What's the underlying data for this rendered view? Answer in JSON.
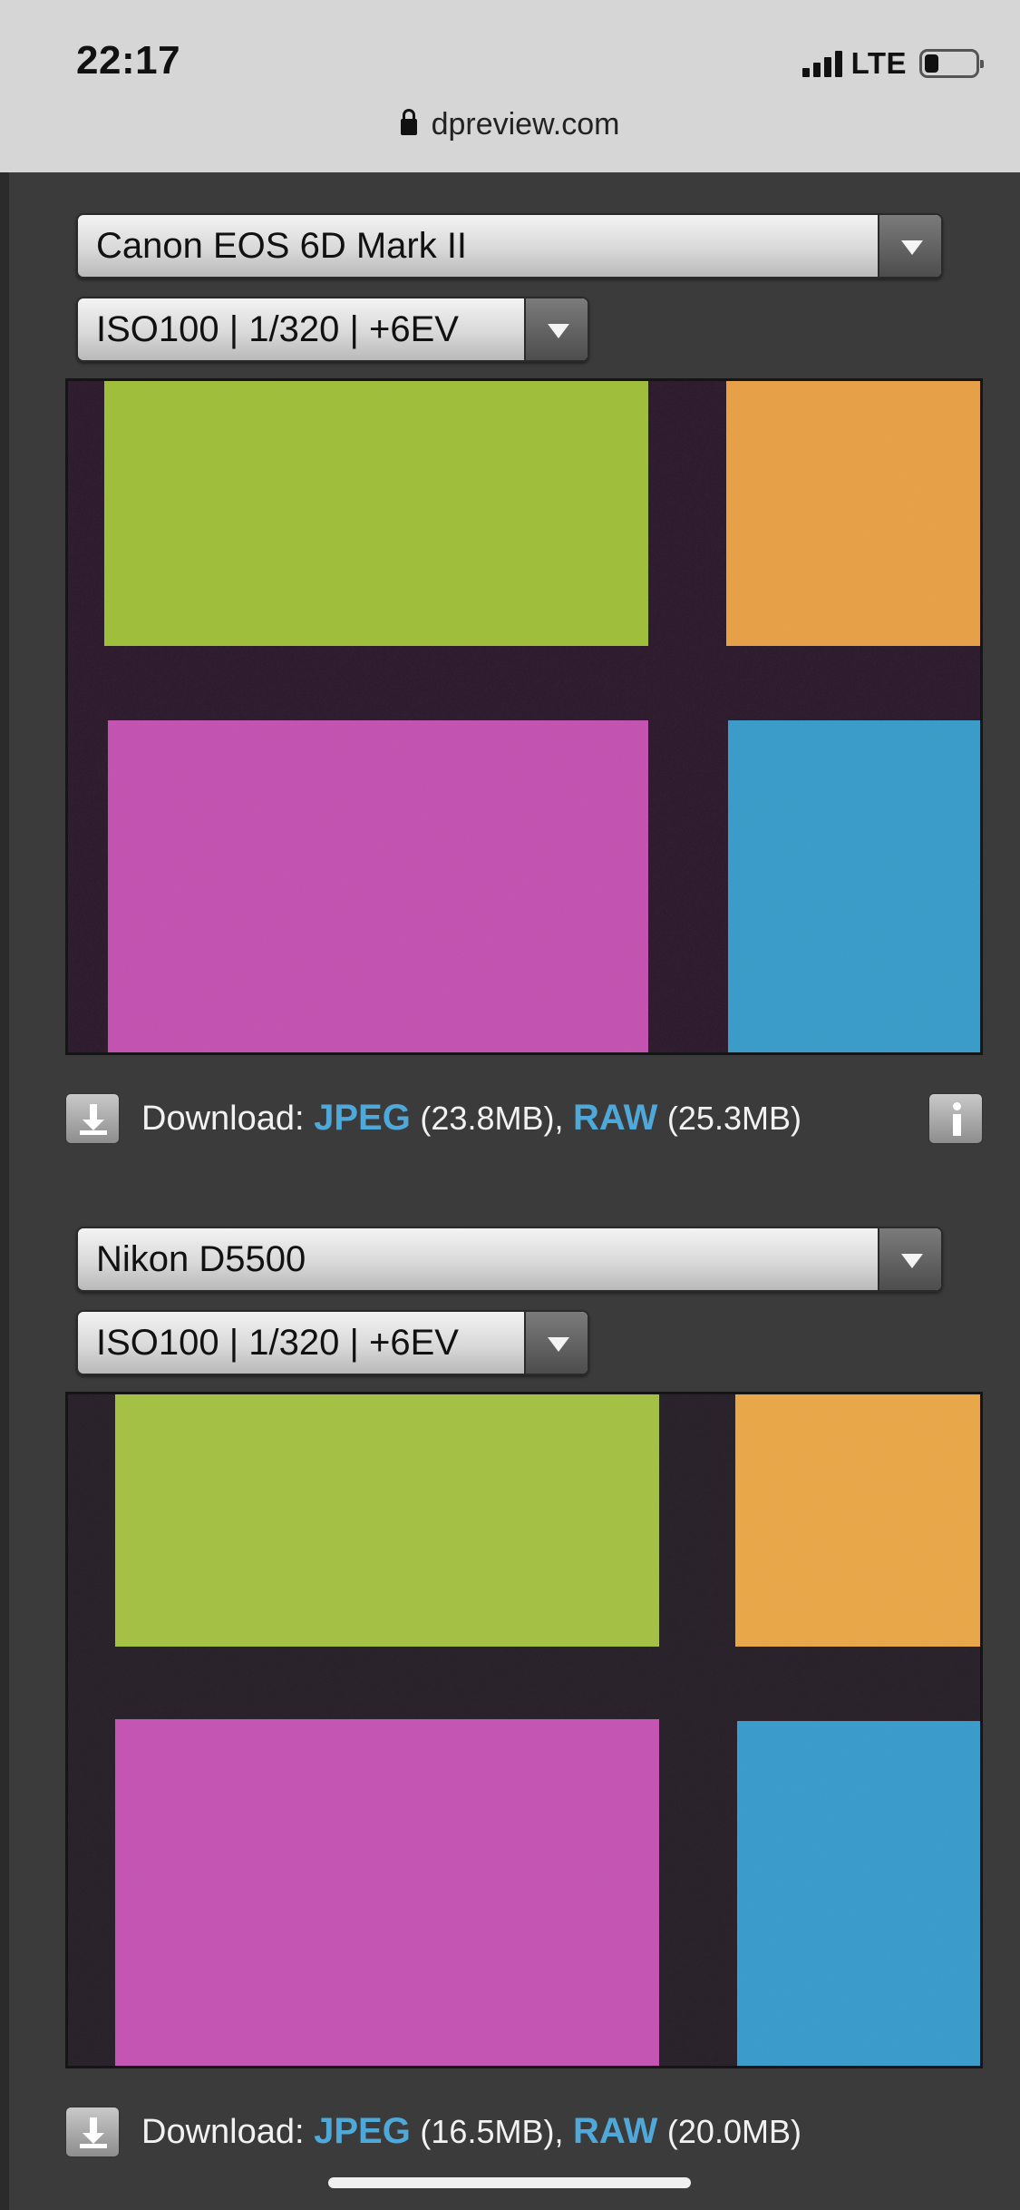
{
  "status_bar": {
    "time": "22:17",
    "network": "LTE",
    "battery_level": 0.25
  },
  "browser": {
    "url": "dpreview.com"
  },
  "comparisons": [
    {
      "camera": "Canon EOS 6D Mark II",
      "settings": "ISO100 | 1/320 | +6EV",
      "download_prefix": "Download: ",
      "jpeg_label": "JPEG",
      "jpeg_size": "(23.8MB),",
      "raw_label": "RAW",
      "raw_size": "(25.3MB)",
      "swatches": {
        "background": "#2e1f2d",
        "green": "#9fbe3c",
        "orange": "#e6a148",
        "magenta": "#c353b0",
        "blue": "#3c9cc9"
      }
    },
    {
      "camera": "Nikon D5500",
      "settings": "ISO100 | 1/320 | +6EV",
      "download_prefix": "Download: ",
      "jpeg_label": "JPEG",
      "jpeg_size": "(16.5MB),",
      "raw_label": "RAW",
      "raw_size": "(20.0MB)",
      "swatches": {
        "background": "#2a2029",
        "green": "#a4c145",
        "orange": "#e8a74a",
        "magenta": "#c455b3",
        "blue": "#3b9ccb"
      }
    }
  ],
  "icons": {
    "download": "download-icon",
    "info": "info-icon",
    "lock": "lock-icon",
    "dropdown": "chevron-down-icon"
  }
}
